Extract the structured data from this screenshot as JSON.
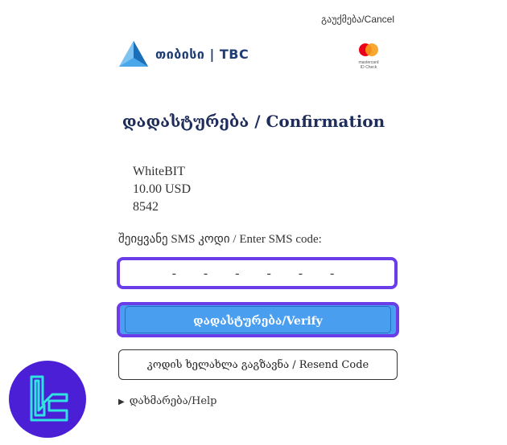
{
  "header": {
    "cancel_label": "გაუქმება/Cancel",
    "bank_name": "თიბისი | TBC",
    "mastercard_line1": "mastercard",
    "mastercard_line2": "ID Check"
  },
  "title": "დადასტურება / Confirmation",
  "details": {
    "merchant": "WhiteBIT",
    "amount": "10.00 USD",
    "card_last4": "8542"
  },
  "sms": {
    "label": "შეიყვანე SMS კოდი / Enter SMS code:",
    "placeholder": "- - - - - -"
  },
  "buttons": {
    "verify_label": "დადასტურება/Verify",
    "resend_label": "კოდის ხელახლა გაგზავნა / Resend Code"
  },
  "help_label": "დახმარება/Help",
  "colors": {
    "accent": "#6a3de8",
    "button_blue": "#4a9ef0",
    "title_navy": "#1f2d5a",
    "corner_logo_bg": "#4b1fd6",
    "corner_logo_stroke": "#2fe3e0"
  }
}
